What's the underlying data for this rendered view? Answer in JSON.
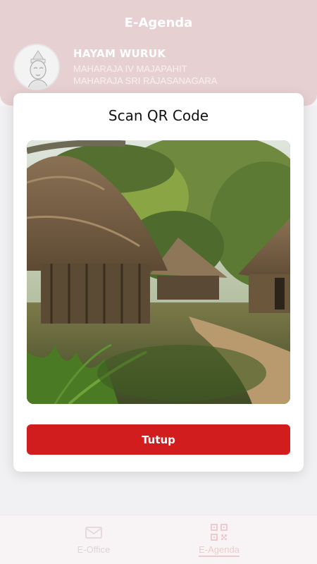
{
  "header": {
    "title": "E-Agenda",
    "user": {
      "name": "HAYAM WURUK",
      "line1": "MAHARAJA IV MAJAPAHIT",
      "line2": "MAHARAJA SRI RĀJASANAGARA"
    }
  },
  "modal": {
    "title": "Scan QR Code",
    "close_label": "Tutup"
  },
  "bottom_nav": {
    "items": [
      {
        "label": "E-Office",
        "icon": "mail-icon"
      },
      {
        "label": "E-Agenda",
        "icon": "qr-code-icon"
      }
    ]
  },
  "colors": {
    "header": "#d9b3b6",
    "button": "#d21d1f",
    "active_nav": "#e3aab0"
  }
}
